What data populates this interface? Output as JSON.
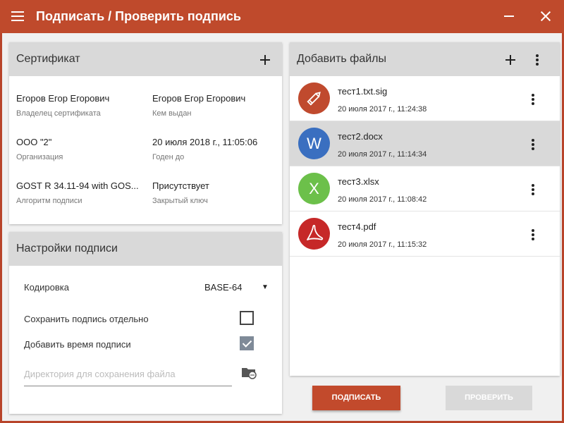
{
  "window": {
    "title": "Подписать / Проверить подпись"
  },
  "certificate": {
    "header": "Сертификат",
    "fields": [
      {
        "value": "Егоров Егор Егорович",
        "label": "Владелец сертификата"
      },
      {
        "value": "Егоров Егор Егорович",
        "label": "Кем выдан"
      },
      {
        "value": "ООО \"2\"",
        "label": "Организация"
      },
      {
        "value": "20 июля 2018 г., 11:05:06",
        "label": "Годен до"
      },
      {
        "value": "GOST R 34.11-94 with GOS...",
        "label": "Алгоритм подписи"
      },
      {
        "value": "Присутствует",
        "label": "Закрытый ключ"
      }
    ]
  },
  "settings": {
    "header": "Настройки подписи",
    "encoding_label": "Кодировка",
    "encoding_value": "BASE-64",
    "save_separately_label": "Сохранить подпись отдельно",
    "save_separately_checked": false,
    "add_time_label": "Добавить время подписи",
    "add_time_checked": true,
    "directory_placeholder": "Директория для сохранения файла",
    "directory_value": ""
  },
  "files": {
    "header": "Добавить файлы",
    "items": [
      {
        "name": "тест1.txt.sig",
        "date": "20 июля 2017 г., 11:24:38",
        "icon": "pencil-icon",
        "color": "#c04a2e",
        "letter": "",
        "selected": false
      },
      {
        "name": "тест2.docx",
        "date": "20 июля 2017 г., 11:14:34",
        "icon": "word-icon",
        "color": "#3a6fc0",
        "letter": "W",
        "selected": true
      },
      {
        "name": "тест3.xlsx",
        "date": "20 июля 2017 г., 11:08:42",
        "icon": "excel-icon",
        "color": "#6cc04a",
        "letter": "X",
        "selected": false
      },
      {
        "name": "тест4.pdf",
        "date": "20 июля 2017 г., 11:15:32",
        "icon": "pdf-icon",
        "color": "#c62828",
        "letter": "",
        "selected": false
      }
    ]
  },
  "actions": {
    "sign_label": "ПОДПИСАТЬ",
    "verify_label": "ПРОВЕРИТЬ"
  },
  "colors": {
    "accent": "#bf4a2c",
    "header_gray": "#d9d9d9",
    "disabled": "#d9d9d9"
  }
}
